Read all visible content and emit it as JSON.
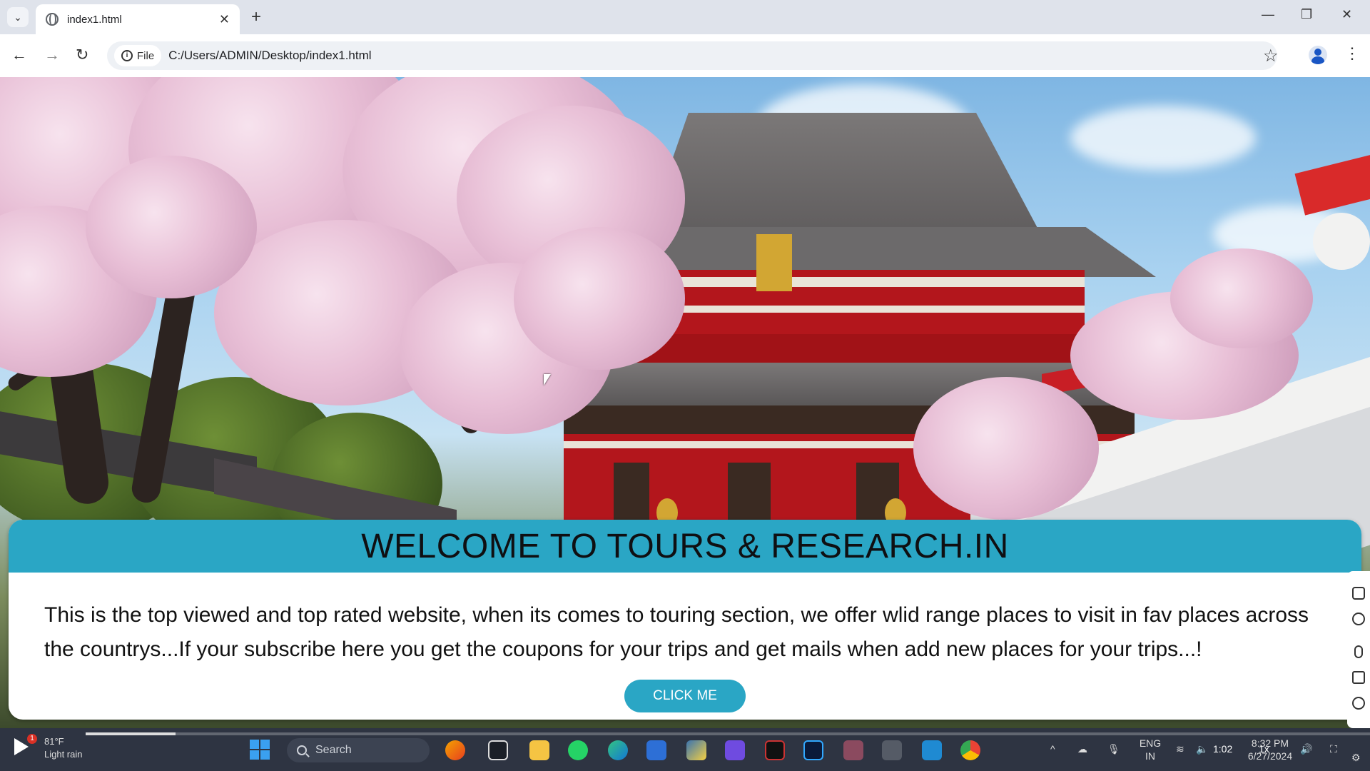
{
  "browser": {
    "tab_title": "index1.html",
    "tab_close": "✕",
    "new_tab": "+",
    "site_chip_label": "File",
    "url": "C:/Users/ADMIN/Desktop/index1.html",
    "icons": [
      "tab-search-icon",
      "page-favicon-icon",
      "back-icon",
      "forward-icon",
      "reload-icon",
      "info-icon",
      "bookmark-star-icon",
      "profile-icon",
      "menu-icon"
    ]
  },
  "window_controls": {
    "minimize": "—",
    "maximize": "❐",
    "close": "✕"
  },
  "hero": {
    "title": "WELCOME TO TOURS & RESEARCH.IN",
    "description": "This is the top viewed and top rated website, when its comes to touring section, we offer wlid range places to visit in fav places across the countrys...If your subscribe here you get the coupons for your trips and get mails when add new places for your trips...!",
    "button_label": "CLICK ME",
    "accent_color": "#2aa6c5"
  },
  "taskbar": {
    "weather_temp": "81°F",
    "weather_desc": "Light rain",
    "weather_badge": "1",
    "search_placeholder": "Search",
    "lang_line1": "ENG",
    "lang_line2": "IN",
    "time": "8:32 PM",
    "date": "6/27/2024",
    "video_time": "1:02",
    "playback_speed": "1x",
    "video_progress": 0.07
  }
}
